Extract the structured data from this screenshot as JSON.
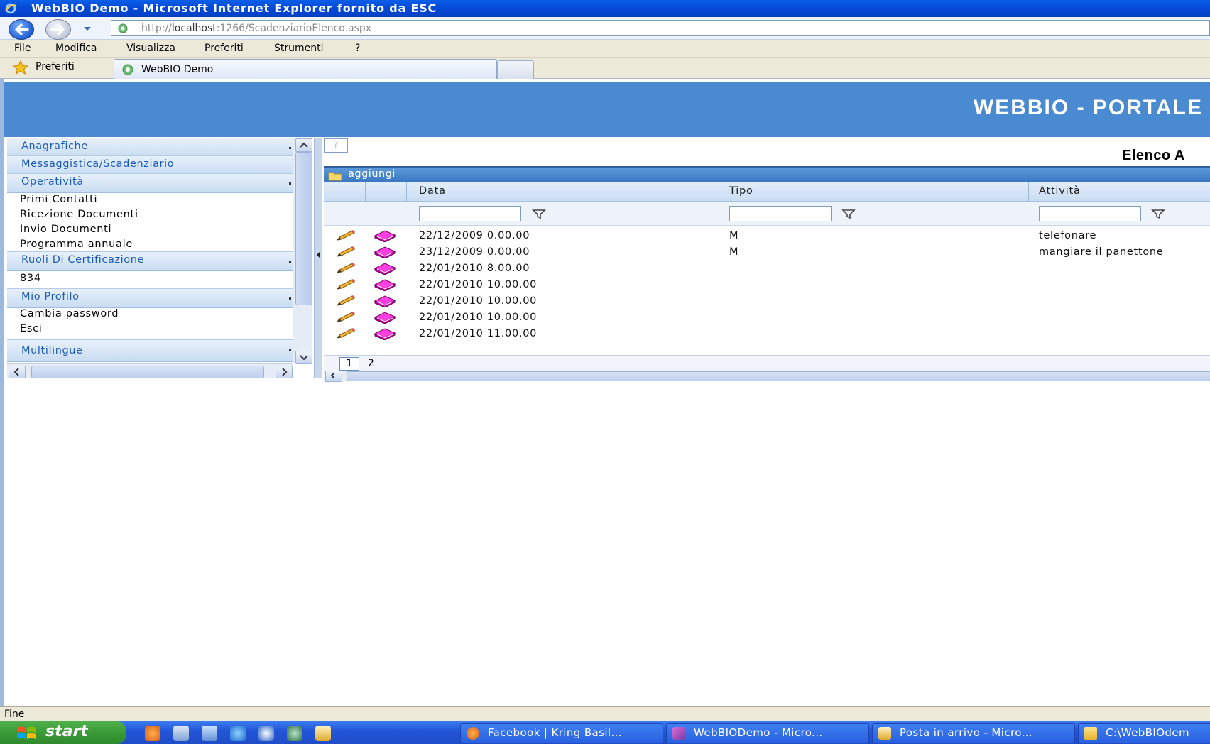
{
  "window": {
    "title": "WebBIO Demo - Microsoft Internet Explorer fornito da ESC"
  },
  "address": {
    "url_prefix": "http://",
    "url_host": "localhost",
    "url_rest": ":1266/ScadenziarioElenco.aspx"
  },
  "menu": {
    "items": [
      "File",
      "Modifica",
      "Visualizza",
      "Preferiti",
      "Strumenti",
      "?"
    ]
  },
  "favorites_label": "Preferiti",
  "tab": {
    "label": "WebBIO Demo"
  },
  "header": {
    "title": "WEBBIO - PORTALE"
  },
  "sidebar": {
    "groups": [
      {
        "label": "Anagrafiche"
      },
      {
        "label": "Messaggistica/Scadenziario"
      },
      {
        "label": "Operatività"
      },
      {
        "label": "Ruoli Di Certificazione"
      },
      {
        "label": "Mio Profilo"
      },
      {
        "label": "Multilingue"
      }
    ],
    "operativita_items": [
      "Primi Contatti",
      "Ricezione Documenti",
      "Invio Documenti",
      "Programma annuale"
    ],
    "ruoli_items": [
      "834"
    ],
    "profilo_items": [
      "Cambia password",
      "Esci"
    ]
  },
  "main": {
    "help_symbol": "?",
    "heading": "Elenco A",
    "toolbar_add_label": "aggiungi",
    "columns": [
      "Data",
      "Tipo",
      "Attività"
    ],
    "rows": [
      {
        "data": "22/12/2009 0.00.00",
        "tipo": "M",
        "attivita": "telefonare"
      },
      {
        "data": "23/12/2009 0.00.00",
        "tipo": "M",
        "attivita": "mangiare il panettone"
      },
      {
        "data": "22/01/2010 8.00.00",
        "tipo": "",
        "attivita": ""
      },
      {
        "data": "22/01/2010 10.00.00",
        "tipo": "",
        "attivita": ""
      },
      {
        "data": "22/01/2010 10.00.00",
        "tipo": "",
        "attivita": ""
      },
      {
        "data": "22/01/2010 10.00.00",
        "tipo": "",
        "attivita": ""
      },
      {
        "data": "22/01/2010 11.00.00",
        "tipo": "",
        "attivita": ""
      }
    ],
    "pager": {
      "current": "1",
      "next": "2"
    }
  },
  "status": {
    "text": "Fine"
  },
  "taskbar": {
    "start_label": "start",
    "tasks": [
      {
        "label": "Facebook | Kring Basil...",
        "icon": "firefox-icon"
      },
      {
        "label": "WebBIODemo - Micro...",
        "icon": "visual-studio-icon"
      },
      {
        "label": "Posta in arrivo - Micro...",
        "icon": "outlook-icon"
      },
      {
        "label": "C:\\WebBIOdem",
        "icon": "folder-icon"
      }
    ]
  },
  "colors": {
    "banner": "#4a8ad0",
    "nav_link": "#1d5cb8",
    "taskbar": "#2456d8",
    "start": "#3a9a37"
  }
}
